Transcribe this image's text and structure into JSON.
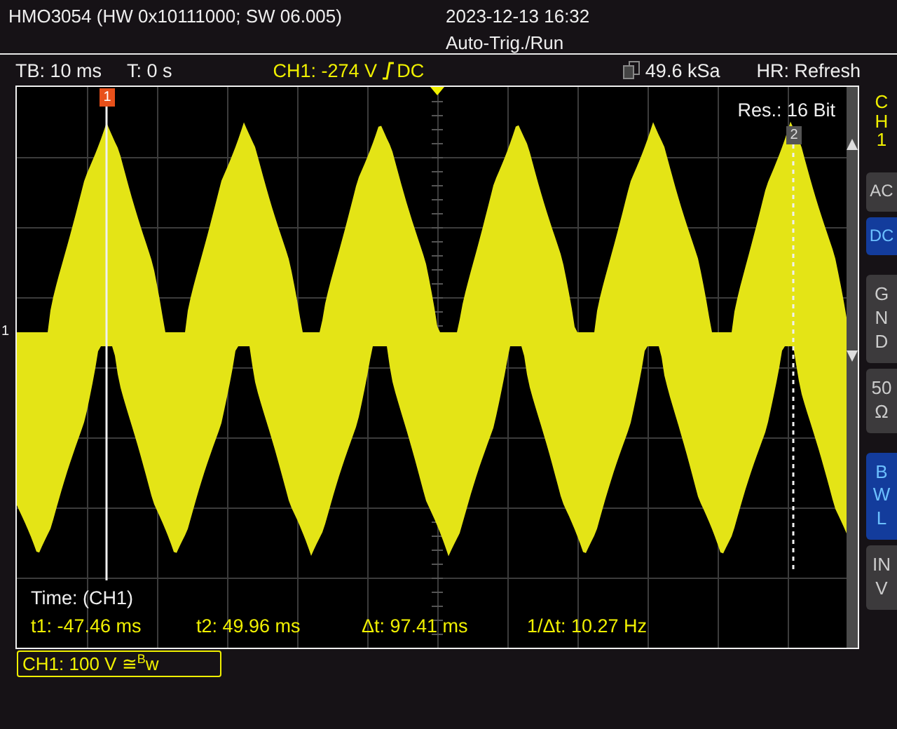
{
  "header": {
    "device": "HMO3054 (HW 0x10111000; SW 06.005)",
    "datetime": "2023-12-13 16:32",
    "acquisition": "Auto-Trig./Run"
  },
  "info_bar": {
    "timebase": "TB: 10 ms",
    "trigger_time": "T: 0 s",
    "trigger_level": "CH1: -274 V",
    "rising_edge": true,
    "trigger_coupling": "DC",
    "sample_rate": "49.6 kSa",
    "mode": "HR: Refresh"
  },
  "screen": {
    "resolution": "Res.: 16 Bit",
    "ground_marker": "1",
    "cursors": [
      {
        "label": "1",
        "kind": "solid"
      },
      {
        "label": "2",
        "kind": "dotted"
      }
    ],
    "measurement_title": "Time: (CH1)",
    "measurements": [
      "t1: -47.46 ms",
      "t2: 49.96 ms",
      "Δt: 97.41 ms",
      "1/Δt: 10.27 Hz"
    ]
  },
  "channel_badge": "CH1: 100 V ≅$^{B}$w",
  "side_panel": {
    "channel": "CH1",
    "buttons": [
      {
        "label": "AC",
        "kind": "inline",
        "selected": false
      },
      {
        "label": "DC",
        "kind": "inline",
        "selected": true
      },
      {
        "label": "GND",
        "kind": "stacked",
        "selected": false
      },
      {
        "label": "50Ω",
        "kind": "pair",
        "selected": false
      },
      {
        "label": "BWL",
        "kind": "stacked",
        "selected": true
      },
      {
        "label": "INV",
        "kind": "stacked",
        "selected": false
      }
    ]
  }
}
